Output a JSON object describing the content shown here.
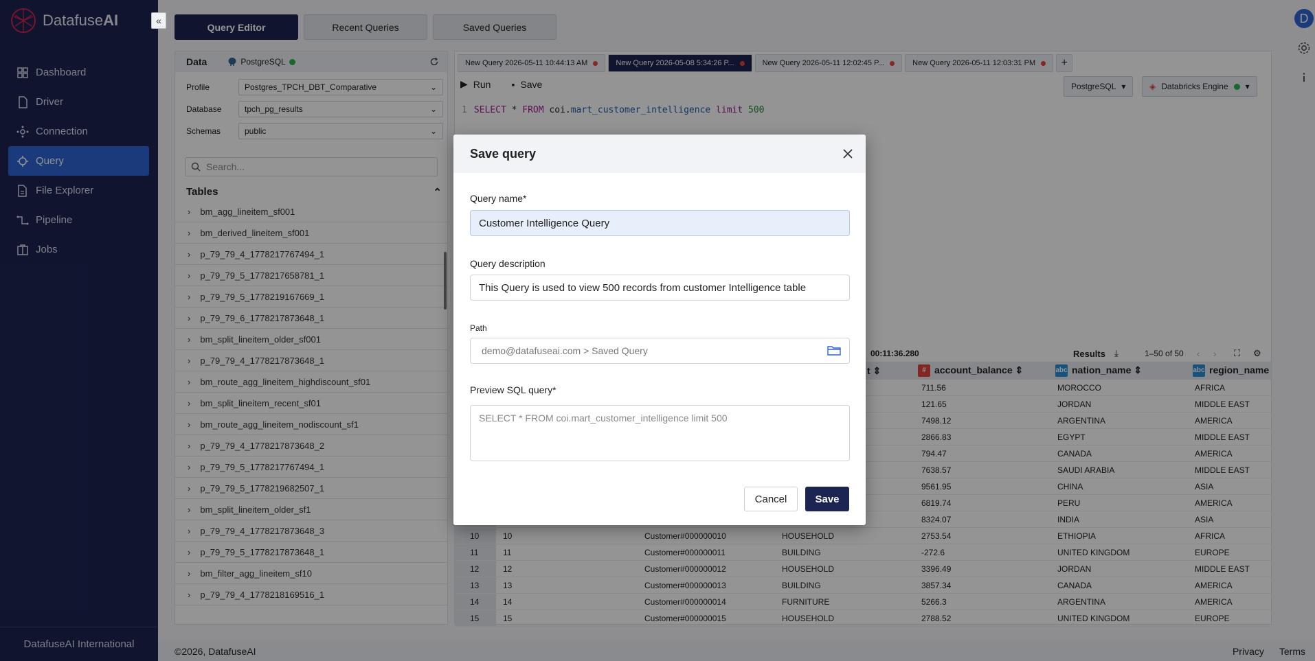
{
  "app": {
    "brand_prefix": "Datafuse",
    "brand_suffix": "AI",
    "collapse_glyph": "«",
    "footer_company": "DatafuseAI International",
    "avatar_letter": "D"
  },
  "nav": {
    "items": [
      {
        "label": "Dashboard",
        "icon": "dashboard-icon"
      },
      {
        "label": "Driver",
        "icon": "driver-icon"
      },
      {
        "label": "Connection",
        "icon": "connection-icon"
      },
      {
        "label": "Query",
        "icon": "query-icon",
        "active": true
      },
      {
        "label": "File Explorer",
        "icon": "file-explorer-icon"
      },
      {
        "label": "Pipeline",
        "icon": "pipeline-icon"
      },
      {
        "label": "Jobs",
        "icon": "jobs-icon"
      }
    ]
  },
  "top_tabs": [
    {
      "label": "Query Editor",
      "active": true
    },
    {
      "label": "Recent Queries"
    },
    {
      "label": "Saved Queries"
    }
  ],
  "data_panel": {
    "title": "Data",
    "db": "PostgreSQL",
    "profile_label": "Profile",
    "profile_value": "Postgres_TPCH_DBT_Comparative",
    "database_label": "Database",
    "database_value": "tpch_pg_results",
    "schemas_label": "Schemas",
    "schemas_value": "public",
    "search_placeholder": "Search...",
    "tables_title": "Tables",
    "tables": [
      "bm_agg_lineitem_sf001",
      "bm_derived_lineitem_sf001",
      "p_79_79_4_1778217767494_1",
      "p_79_79_5_1778217658781_1",
      "p_79_79_5_1778219167669_1",
      "p_79_79_6_1778217873648_1",
      "bm_split_lineitem_older_sf001",
      "p_79_79_4_1778217873648_1",
      "bm_route_agg_lineitem_highdiscount_sf01",
      "bm_split_lineitem_recent_sf01",
      "bm_route_agg_lineitem_nodiscount_sf1",
      "p_79_79_4_1778217873648_2",
      "p_79_79_5_1778217767494_1",
      "p_79_79_5_1778219682507_1",
      "bm_split_lineitem_older_sf1",
      "p_79_79_4_1778217873648_3",
      "p_79_79_5_1778217873648_1",
      "bm_filter_agg_lineitem_sf10",
      "p_79_79_4_1778218169516_1"
    ]
  },
  "editor": {
    "tabs": [
      "New Query 2026-05-11 10:44:13 AM",
      "New Query 2026-05-08 5:34:26 P...",
      "New Query 2026-05-11 12:02:45 P...",
      "New Query 2026-05-11 12:03:31 PM"
    ],
    "active_tab": 1,
    "plus": "+",
    "run_label": "Run",
    "save_label": "Save",
    "dialect": "PostgreSQL",
    "engine": "Databricks Engine",
    "code": {
      "line_no": "1",
      "select": "SELECT",
      "star": " * ",
      "from": "FROM",
      "schema": " coi.",
      "table": "mart_customer_intelligence",
      "limit": " limit ",
      "num": "500"
    }
  },
  "results": {
    "elapsed": "00:11:36.280",
    "label": "Results",
    "pager": "1–50 of 50",
    "columns": [
      {
        "name": "t",
        "badge": ""
      },
      {
        "name": "account_balance",
        "badge": "#",
        "color": "#e0443c"
      },
      {
        "name": "nation_name",
        "badge": "abc",
        "color": "#2a8fd8"
      },
      {
        "name": "region_name",
        "badge": "abc",
        "color": "#2a8fd8"
      }
    ],
    "rows": [
      [
        "",
        "",
        "",
        "",
        "711.56",
        "MOROCCO",
        "AFRICA"
      ],
      [
        "",
        "",
        "",
        "",
        "121.65",
        "JORDAN",
        "MIDDLE EAST"
      ],
      [
        "",
        "",
        "",
        "",
        "7498.12",
        "ARGENTINA",
        "AMERICA"
      ],
      [
        "",
        "",
        "",
        "",
        "2866.83",
        "EGYPT",
        "MIDDLE EAST"
      ],
      [
        "",
        "",
        "",
        "",
        "794.47",
        "CANADA",
        "AMERICA"
      ],
      [
        "",
        "",
        "",
        "",
        "7638.57",
        "SAUDI ARABIA",
        "MIDDLE EAST"
      ],
      [
        "",
        "",
        "",
        "",
        "9561.95",
        "CHINA",
        "ASIA"
      ],
      [
        "",
        "",
        "",
        "",
        "6819.74",
        "PERU",
        "AMERICA"
      ],
      [
        "",
        "",
        "",
        "",
        "8324.07",
        "INDIA",
        "ASIA"
      ],
      [
        "10",
        "10",
        "Customer#000000010",
        "HOUSEHOLD",
        "2753.54",
        "ETHIOPIA",
        "AFRICA"
      ],
      [
        "11",
        "11",
        "Customer#000000011",
        "BUILDING",
        "-272.6",
        "UNITED KINGDOM",
        "EUROPE"
      ],
      [
        "12",
        "12",
        "Customer#000000012",
        "HOUSEHOLD",
        "3396.49",
        "JORDAN",
        "MIDDLE EAST"
      ],
      [
        "13",
        "13",
        "Customer#000000013",
        "BUILDING",
        "3857.34",
        "CANADA",
        "AMERICA"
      ],
      [
        "14",
        "14",
        "Customer#000000014",
        "FURNITURE",
        "5266.3",
        "ARGENTINA",
        "AMERICA"
      ],
      [
        "15",
        "15",
        "Customer#000000015",
        "HOUSEHOLD",
        "2788.52",
        "UNITED KINGDOM",
        "EUROPE"
      ]
    ]
  },
  "footer": {
    "copyright": "©2026, DatafuseAI",
    "privacy": "Privacy",
    "terms": "Terms"
  },
  "modal": {
    "title": "Save query",
    "name_label": "Query name*",
    "name_value": "Customer Intelligence Query",
    "desc_label": "Query description",
    "desc_value": "This Query is used to view 500 records from customer Intelligence table",
    "path_label": "Path",
    "path_value": "demo@datafuseai.com > Saved Query",
    "preview_label": "Preview SQL query*",
    "preview_value": "SELECT * FROM coi.mart_customer_intelligence limit 500",
    "cancel_label": "Cancel",
    "save_label": "Save"
  },
  "colors": {
    "sidebar": "#1c2452",
    "accent": "#2d64d4",
    "success": "#2fb24a",
    "danger": "#e0443c"
  }
}
